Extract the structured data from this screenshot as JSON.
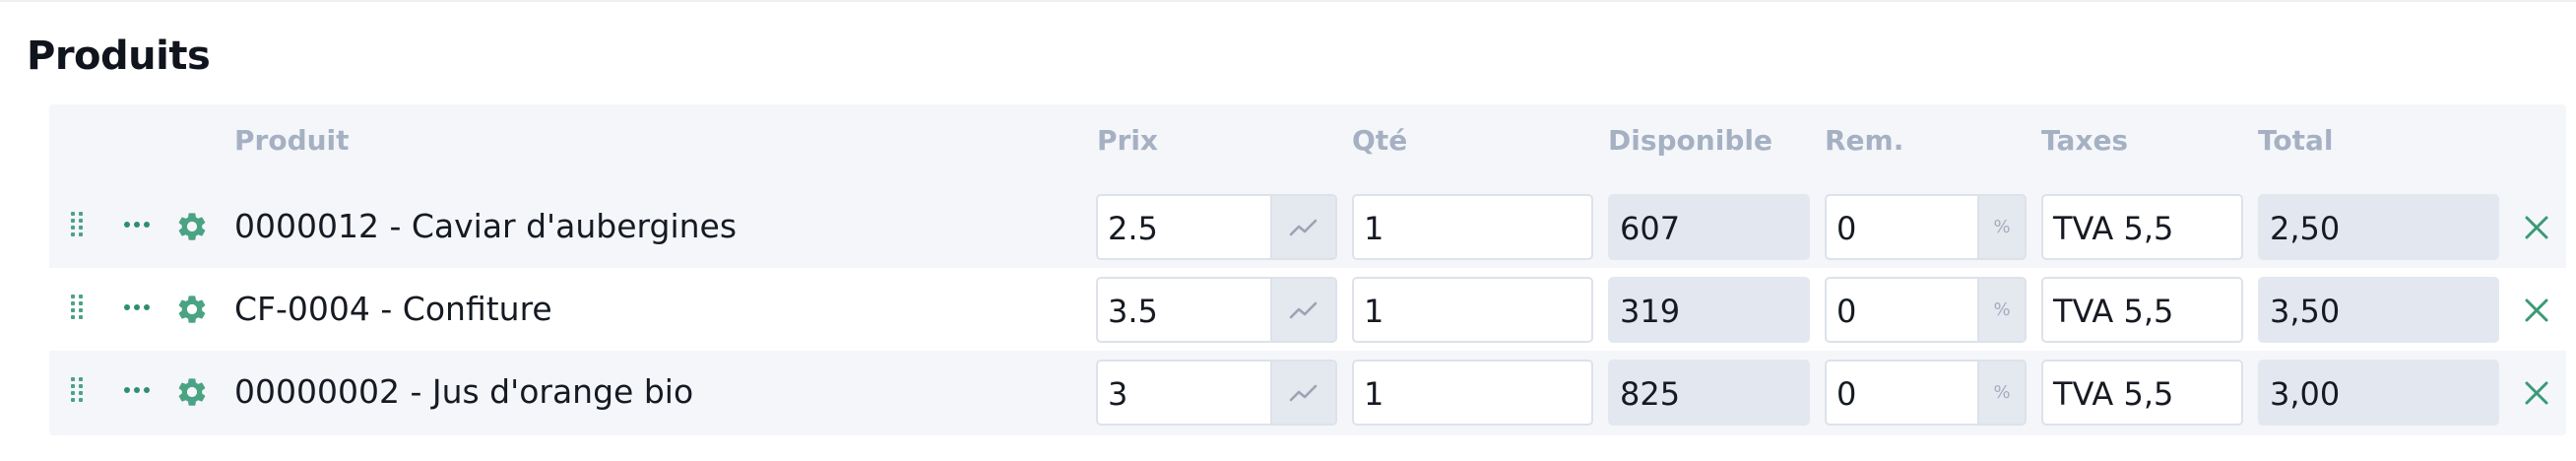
{
  "section": {
    "title": "Produits"
  },
  "table": {
    "headers": {
      "product": "Produit",
      "price": "Prix",
      "qty": "Qté",
      "available": "Disponible",
      "discount": "Rem.",
      "taxes": "Taxes",
      "total": "Total"
    },
    "discount_unit": "%",
    "rows": [
      {
        "product": "0000012 - Caviar d'aubergines",
        "price": "2.5",
        "qty": "1",
        "available": "607",
        "discount": "0",
        "taxes": "TVA 5,5",
        "total": "2,50"
      },
      {
        "product": "CF-0004 - Confiture",
        "price": "3.5",
        "qty": "1",
        "available": "319",
        "discount": "0",
        "taxes": "TVA 5,5",
        "total": "3,50"
      },
      {
        "product": "00000002 - Jus d'orange bio",
        "price": "3",
        "qty": "1",
        "available": "825",
        "discount": "0",
        "taxes": "TVA 5,5",
        "total": "3,00"
      }
    ]
  },
  "colors": {
    "accent": "#2f8f6c",
    "header_text": "#a5b1c3",
    "readonly_bg": "#e3e8f0"
  },
  "icons": {
    "drag": "drag-handle-icon",
    "menu": "more-dots-icon",
    "settings": "gear-icon",
    "price_history": "trend-chart-icon",
    "remove": "close-icon"
  }
}
